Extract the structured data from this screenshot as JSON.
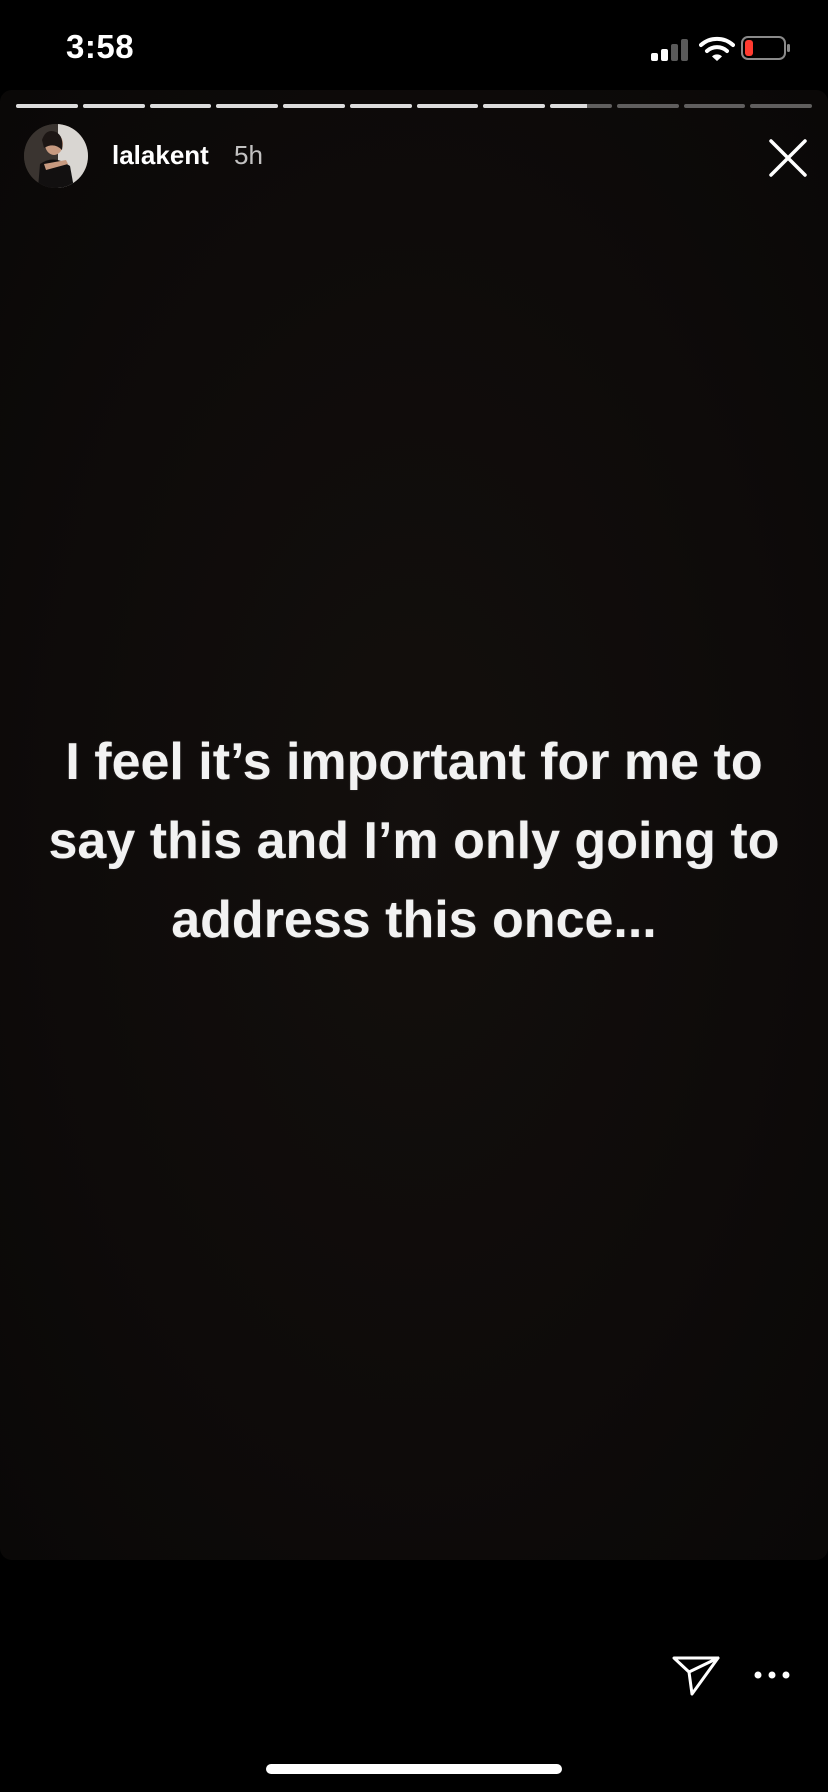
{
  "status_bar": {
    "time": "3:58",
    "signal_icon": "cellular-signal-icon",
    "wifi_icon": "wifi-icon",
    "battery_icon": "battery-low-icon",
    "battery_color": "#ff3b30"
  },
  "story": {
    "segment_count": 12,
    "current_segment": 9,
    "current_segment_progress": 0.6,
    "user": {
      "username": "lalakent",
      "time_ago": "5h",
      "avatar_icon": "profile-avatar"
    },
    "close_icon": "close-icon",
    "text": "I feel it’s important for me to say this and I’m only going to address this once...",
    "background_color": "#0e0b0a"
  },
  "footer": {
    "share_icon": "send-paper-plane-icon",
    "more_icon": "more-options-icon"
  }
}
